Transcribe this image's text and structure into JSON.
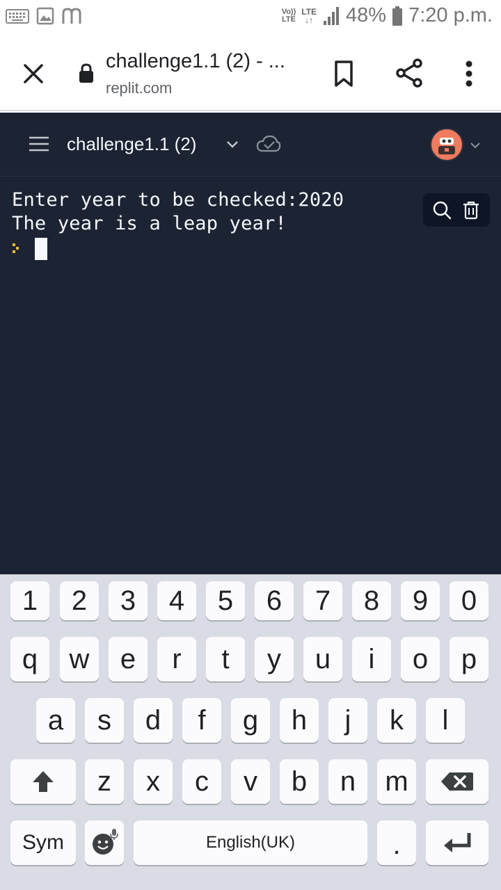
{
  "status_bar": {
    "volte_label": "Vo)) LTE",
    "lte_label": "LTE",
    "battery": "48%",
    "time": "7:20 p.m."
  },
  "browser": {
    "page_title": "challenge1.1 (2) - ...",
    "domain": "replit.com"
  },
  "replit": {
    "repl_name": "challenge1.1 (2)"
  },
  "console": {
    "lines": [
      "Enter year to be checked:2020",
      "The year is a leap year!"
    ]
  },
  "keyboard": {
    "row_numbers": [
      "1",
      "2",
      "3",
      "4",
      "5",
      "6",
      "7",
      "8",
      "9",
      "0"
    ],
    "row1": [
      "q",
      "w",
      "e",
      "r",
      "t",
      "y",
      "u",
      "i",
      "o",
      "p"
    ],
    "row2": [
      "a",
      "s",
      "d",
      "f",
      "g",
      "h",
      "j",
      "k",
      "l"
    ],
    "row3": [
      "z",
      "x",
      "c",
      "v",
      "b",
      "n",
      "m"
    ],
    "sym_label": "Sym",
    "space_label": "English(UK)",
    "period_label": "."
  },
  "colors": {
    "replit_bg": "#1c2333",
    "avatar_bg": "#f07b5e",
    "prompt_color": "#e5b93c",
    "keyboard_bg": "#d9dce4"
  },
  "icons": {
    "close": "close-icon",
    "lock": "lock-icon",
    "bookmark": "bookmark-icon",
    "share": "share-icon",
    "more": "more-vertical-icon",
    "hamburger": "hamburger-menu-icon",
    "chevron": "chevron-down-icon",
    "cloud": "cloud-check-icon",
    "search": "search-icon",
    "trash": "trash-icon",
    "shift": "shift-arrow-icon",
    "backspace": "backspace-icon",
    "emoji": "emoji-mic-icon",
    "enter": "enter-icon"
  }
}
